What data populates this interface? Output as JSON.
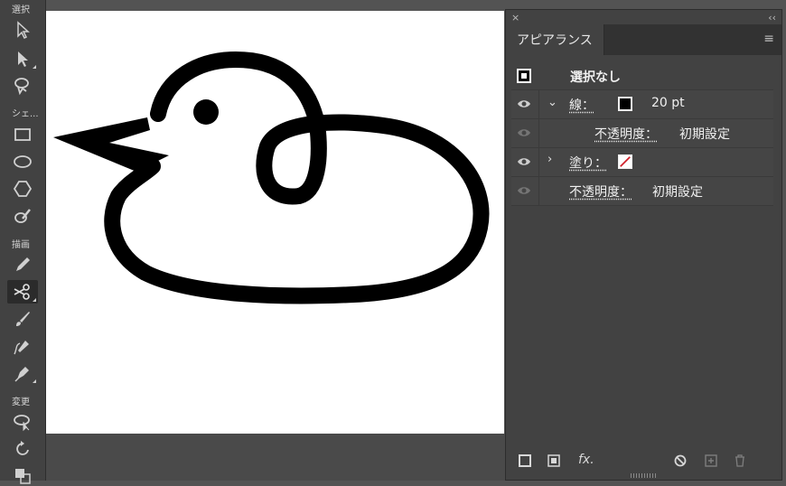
{
  "toolbar": {
    "section_select": "選択",
    "section_shape": "シェ...",
    "section_draw": "描画",
    "section_transform": "変更"
  },
  "panel": {
    "title": "アピアランス",
    "close_glyph": "×",
    "collapse_glyph": "‹‹",
    "menu_glyph": "≡",
    "rows": {
      "header_label": "選択なし",
      "stroke_label": "線：",
      "stroke_value": "20 pt",
      "stroke_opacity_label": "不透明度：",
      "stroke_opacity_value": "初期設定",
      "fill_label": "塗り：",
      "opacity_label": "不透明度：",
      "opacity_value": "初期設定"
    },
    "bottom": {
      "fx_label": "fx."
    }
  },
  "colors": {
    "panel_bg": "#424242",
    "fill_none_slash": "#d0202a",
    "stroke_color": "#000000"
  }
}
